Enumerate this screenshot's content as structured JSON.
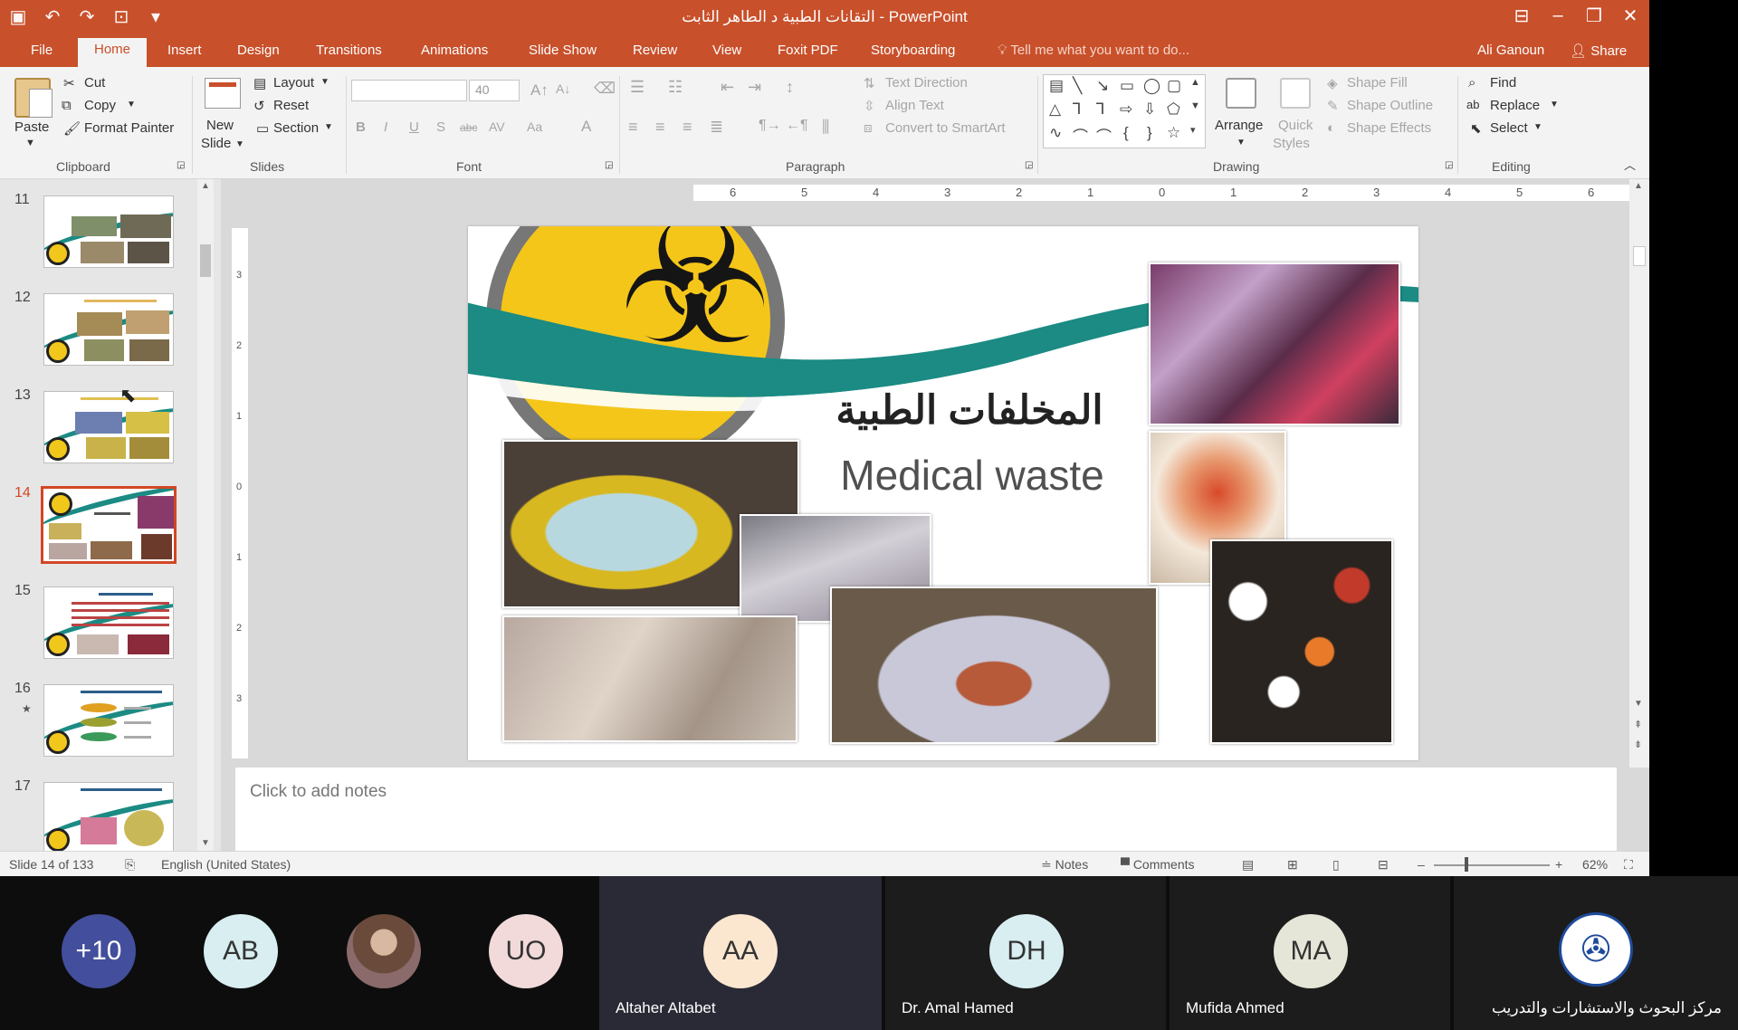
{
  "window": {
    "title": "التقانات الطبية د الطاهر الثابت - PowerPoint",
    "user": "Ali Ganoun",
    "share_label": "Share"
  },
  "tabs": [
    {
      "label": "File"
    },
    {
      "label": "Home"
    },
    {
      "label": "Insert"
    },
    {
      "label": "Design"
    },
    {
      "label": "Transitions"
    },
    {
      "label": "Animations"
    },
    {
      "label": "Slide Show"
    },
    {
      "label": "Review"
    },
    {
      "label": "View"
    },
    {
      "label": "Foxit PDF"
    },
    {
      "label": "Storyboarding"
    }
  ],
  "tell_me": "Tell me what you want to do...",
  "ribbon": {
    "clipboard": {
      "paste": "Paste",
      "cut": "Cut",
      "copy": "Copy",
      "format_painter": "Format Painter",
      "label": "Clipboard"
    },
    "slides": {
      "new_slide": "New",
      "new_slide_2": "Slide",
      "layout": "Layout",
      "reset": "Reset",
      "section": "Section",
      "label": "Slides"
    },
    "font": {
      "size": "40",
      "label": "Font"
    },
    "paragraph": {
      "text_direction": "Text Direction",
      "align_text": "Align Text",
      "convert_smartart": "Convert to SmartArt",
      "label": "Paragraph"
    },
    "drawing": {
      "arrange": "Arrange",
      "quick": "Quick",
      "styles": "Styles",
      "shape_fill": "Shape Fill",
      "shape_outline": "Shape Outline",
      "shape_effects": "Shape Effects",
      "label": "Drawing"
    },
    "editing": {
      "find": "Find",
      "replace": "Replace",
      "select": "Select",
      "label": "Editing"
    }
  },
  "slides": {
    "items": [
      {
        "number": "11"
      },
      {
        "number": "12"
      },
      {
        "number": "13"
      },
      {
        "number": "14",
        "selected": true
      },
      {
        "number": "15"
      },
      {
        "number": "16"
      },
      {
        "number": "17"
      }
    ]
  },
  "ruler": {
    "h_ticks": [
      "6",
      "5",
      "4",
      "3",
      "2",
      "1",
      "0",
      "1",
      "2",
      "3",
      "4",
      "5",
      "6"
    ],
    "v_ticks": [
      "3",
      "2",
      "1",
      "0",
      "1",
      "2",
      "3"
    ]
  },
  "slide": {
    "arabic_title": "المخلفات الطبية",
    "title": "Medical waste",
    "colors": {
      "teal": "#1b8b84",
      "yellow": "#f5c61a"
    }
  },
  "notes_placeholder": "Click to add notes",
  "status": {
    "slide_info": "Slide 14 of 133",
    "language": "English (United States)",
    "notes": "Notes",
    "comments": "Comments",
    "zoom": "62%"
  },
  "meeting": {
    "overflow_count": "+10",
    "participants": [
      {
        "initials": "AB",
        "name": ""
      },
      {
        "initials": "",
        "name": ""
      },
      {
        "initials": "UO",
        "name": ""
      },
      {
        "initials": "AA",
        "name": "Altaher Altabet"
      },
      {
        "initials": "DH",
        "name": "Dr. Amal Hamed"
      },
      {
        "initials": "MA",
        "name": "Mufida Ahmed"
      },
      {
        "initials": "",
        "name": "مركز البحوث والاستشارات والتدريب"
      }
    ]
  }
}
